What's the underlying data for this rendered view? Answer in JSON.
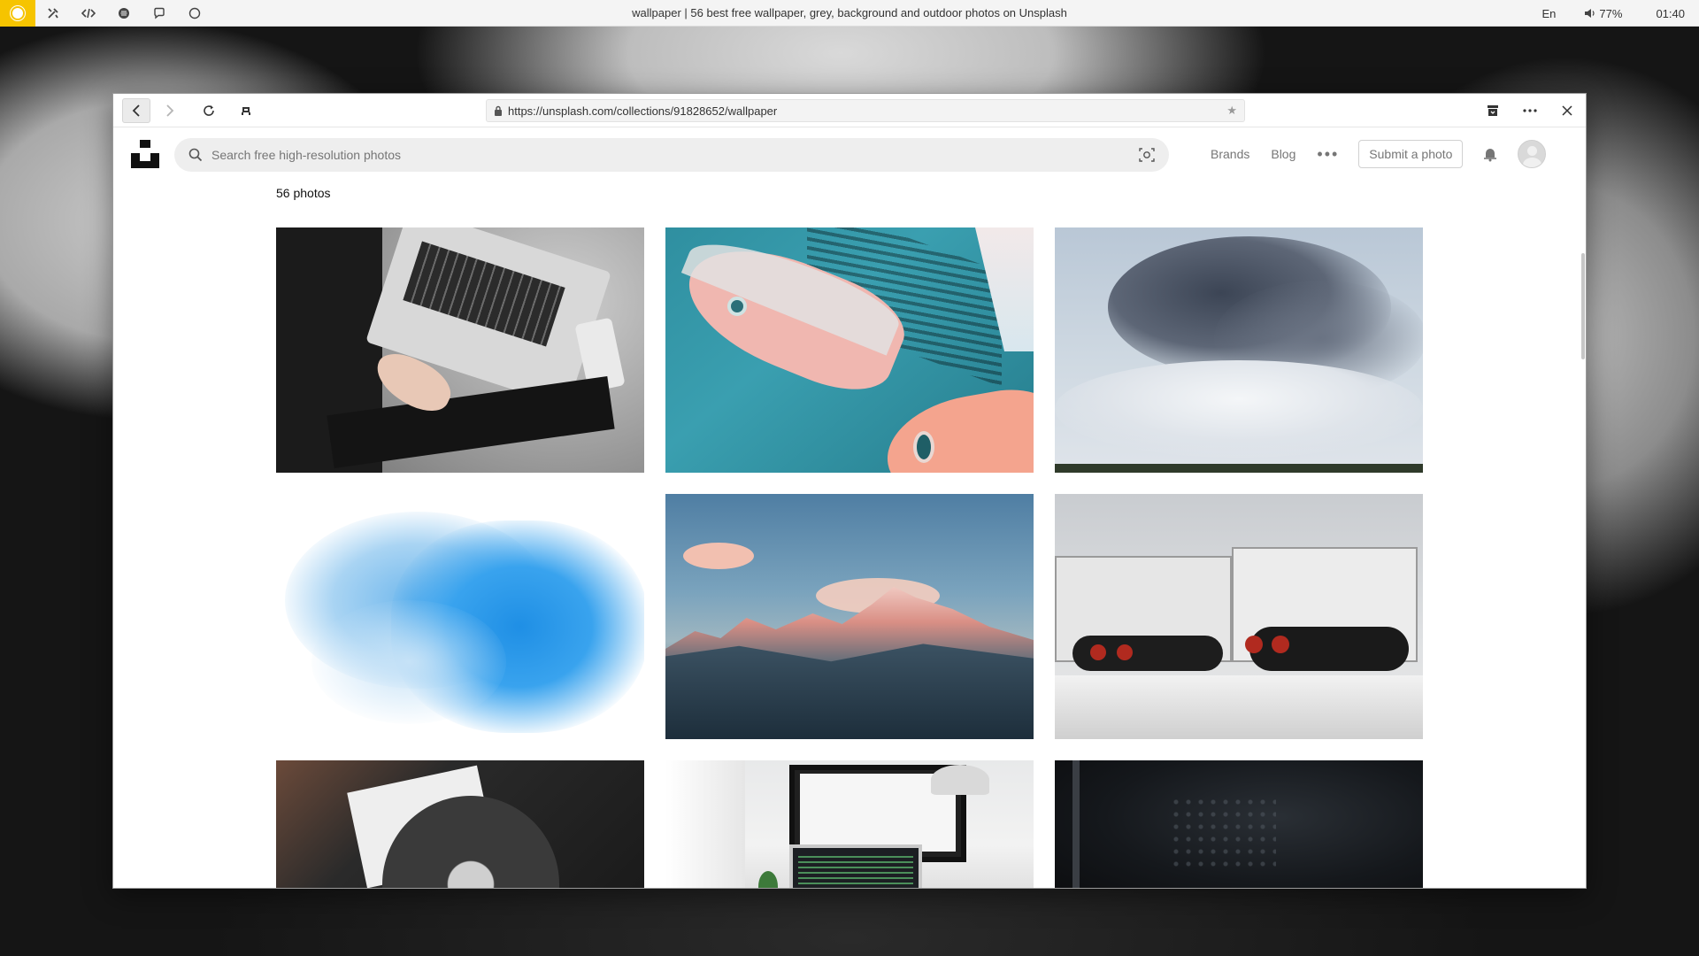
{
  "system_panel": {
    "window_title": "wallpaper | 56 best free wallpaper, grey, background and outdoor photos on Unsplash",
    "keyboard_layout": "En",
    "volume_percent": "77%",
    "clock": "01:40",
    "launcher_color": "#f6c400",
    "icons": [
      "launcher-icon",
      "tools-icon",
      "code-icon",
      "music-icon",
      "chat-icon",
      "circle-icon"
    ]
  },
  "browser": {
    "url": "https://unsplash.com/collections/91828652/wallpaper",
    "icons": [
      "back-icon",
      "forward-icon",
      "reload-icon",
      "extension-icon",
      "lock-icon",
      "bookmark-star-icon",
      "archive-icon",
      "more-icon",
      "close-icon"
    ]
  },
  "site": {
    "search_placeholder": "Search free high-resolution photos",
    "nav": {
      "brands": "Brands",
      "blog": "Blog",
      "more": "•••",
      "submit": "Submit a photo"
    },
    "photo_count": "56 photos"
  },
  "photos": [
    {
      "subject": "laptop on grey rug"
    },
    {
      "subject": "fish mural on building"
    },
    {
      "subject": "volcanic smoke cloud"
    },
    {
      "subject": "blue ink in water"
    },
    {
      "subject": "snowy mountains at sunset"
    },
    {
      "subject": "lego robots"
    },
    {
      "subject": "turntable with record"
    },
    {
      "subject": "desk with monitor and laptop"
    },
    {
      "subject": "dark surface"
    }
  ]
}
